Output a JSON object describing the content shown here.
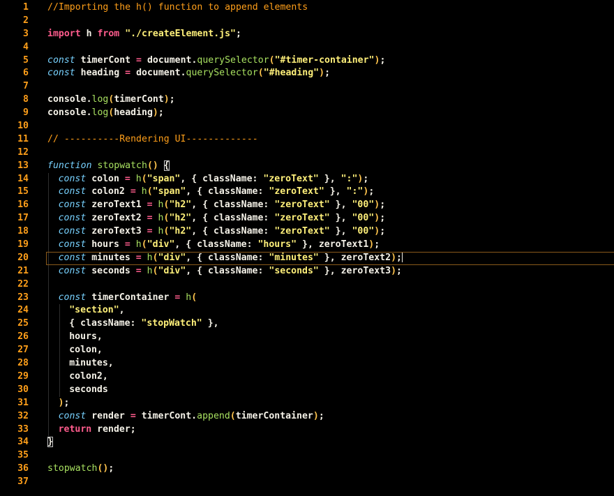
{
  "editor": {
    "current_line": 20,
    "lines": [
      {
        "n": "1",
        "tokens": [
          {
            "t": "//Importing the h() function to append elements",
            "c": "comment"
          }
        ]
      },
      {
        "n": "2",
        "tokens": []
      },
      {
        "n": "3",
        "tokens": [
          {
            "t": "import",
            "c": "kw"
          },
          {
            "t": " h ",
            "c": "plain"
          },
          {
            "t": "from",
            "c": "kw"
          },
          {
            "t": " ",
            "c": "plain"
          },
          {
            "t": "\"./createElement.js\"",
            "c": "str"
          },
          {
            "t": ";",
            "c": "plain"
          }
        ]
      },
      {
        "n": "4",
        "tokens": []
      },
      {
        "n": "5",
        "tokens": [
          {
            "t": "const",
            "c": "storage"
          },
          {
            "t": " timerCont ",
            "c": "plain"
          },
          {
            "t": "=",
            "c": "kw"
          },
          {
            "t": " document.",
            "c": "plain"
          },
          {
            "t": "querySelector",
            "c": "fn"
          },
          {
            "t": "(",
            "c": "punct"
          },
          {
            "t": "\"#timer-container\"",
            "c": "str"
          },
          {
            "t": ")",
            "c": "punct"
          },
          {
            "t": ";",
            "c": "plain"
          }
        ]
      },
      {
        "n": "6",
        "tokens": [
          {
            "t": "const",
            "c": "storage"
          },
          {
            "t": " heading ",
            "c": "plain"
          },
          {
            "t": "=",
            "c": "kw"
          },
          {
            "t": " document.",
            "c": "plain"
          },
          {
            "t": "querySelector",
            "c": "fn"
          },
          {
            "t": "(",
            "c": "punct"
          },
          {
            "t": "\"#heading\"",
            "c": "str"
          },
          {
            "t": ")",
            "c": "punct"
          },
          {
            "t": ";",
            "c": "plain"
          }
        ]
      },
      {
        "n": "7",
        "tokens": []
      },
      {
        "n": "8",
        "tokens": [
          {
            "t": "console.",
            "c": "plain"
          },
          {
            "t": "log",
            "c": "fn"
          },
          {
            "t": "(",
            "c": "punct"
          },
          {
            "t": "timerCont",
            "c": "plain"
          },
          {
            "t": ")",
            "c": "punct"
          },
          {
            "t": ";",
            "c": "plain"
          }
        ]
      },
      {
        "n": "9",
        "tokens": [
          {
            "t": "console.",
            "c": "plain"
          },
          {
            "t": "log",
            "c": "fn"
          },
          {
            "t": "(",
            "c": "punct"
          },
          {
            "t": "heading",
            "c": "plain"
          },
          {
            "t": ")",
            "c": "punct"
          },
          {
            "t": ";",
            "c": "plain"
          }
        ]
      },
      {
        "n": "10",
        "tokens": []
      },
      {
        "n": "11",
        "tokens": [
          {
            "t": "// ----------Rendering UI-------------",
            "c": "comment"
          }
        ]
      },
      {
        "n": "12",
        "tokens": []
      },
      {
        "n": "13",
        "tokens": [
          {
            "t": "function",
            "c": "storage"
          },
          {
            "t": " ",
            "c": "plain"
          },
          {
            "t": "stopwatch",
            "c": "fn"
          },
          {
            "t": "() ",
            "c": "punct"
          },
          {
            "t": "{",
            "c": "bracket"
          }
        ]
      },
      {
        "n": "14",
        "indent": 1,
        "tokens": [
          {
            "t": "const",
            "c": "storage"
          },
          {
            "t": " colon ",
            "c": "plain"
          },
          {
            "t": "=",
            "c": "kw"
          },
          {
            "t": " ",
            "c": "plain"
          },
          {
            "t": "h",
            "c": "fn"
          },
          {
            "t": "(",
            "c": "punct"
          },
          {
            "t": "\"span\"",
            "c": "str"
          },
          {
            "t": ", { className: ",
            "c": "plain"
          },
          {
            "t": "\"zeroText\"",
            "c": "str"
          },
          {
            "t": " }, ",
            "c": "plain"
          },
          {
            "t": "\":\"",
            "c": "str"
          },
          {
            "t": ")",
            "c": "punct"
          },
          {
            "t": ";",
            "c": "plain"
          }
        ]
      },
      {
        "n": "15",
        "indent": 1,
        "tokens": [
          {
            "t": "const",
            "c": "storage"
          },
          {
            "t": " colon2 ",
            "c": "plain"
          },
          {
            "t": "=",
            "c": "kw"
          },
          {
            "t": " ",
            "c": "plain"
          },
          {
            "t": "h",
            "c": "fn"
          },
          {
            "t": "(",
            "c": "punct"
          },
          {
            "t": "\"span\"",
            "c": "str"
          },
          {
            "t": ", { className: ",
            "c": "plain"
          },
          {
            "t": "\"zeroText\"",
            "c": "str"
          },
          {
            "t": " }, ",
            "c": "plain"
          },
          {
            "t": "\":\"",
            "c": "str"
          },
          {
            "t": ")",
            "c": "punct"
          },
          {
            "t": ";",
            "c": "plain"
          }
        ]
      },
      {
        "n": "16",
        "indent": 1,
        "tokens": [
          {
            "t": "const",
            "c": "storage"
          },
          {
            "t": " zeroText1 ",
            "c": "plain"
          },
          {
            "t": "=",
            "c": "kw"
          },
          {
            "t": " ",
            "c": "plain"
          },
          {
            "t": "h",
            "c": "fn"
          },
          {
            "t": "(",
            "c": "punct"
          },
          {
            "t": "\"h2\"",
            "c": "str"
          },
          {
            "t": ", { className: ",
            "c": "plain"
          },
          {
            "t": "\"zeroText\"",
            "c": "str"
          },
          {
            "t": " }, ",
            "c": "plain"
          },
          {
            "t": "\"00\"",
            "c": "str"
          },
          {
            "t": ")",
            "c": "punct"
          },
          {
            "t": ";",
            "c": "plain"
          }
        ]
      },
      {
        "n": "17",
        "indent": 1,
        "tokens": [
          {
            "t": "const",
            "c": "storage"
          },
          {
            "t": " zeroText2 ",
            "c": "plain"
          },
          {
            "t": "=",
            "c": "kw"
          },
          {
            "t": " ",
            "c": "plain"
          },
          {
            "t": "h",
            "c": "fn"
          },
          {
            "t": "(",
            "c": "punct"
          },
          {
            "t": "\"h2\"",
            "c": "str"
          },
          {
            "t": ", { className: ",
            "c": "plain"
          },
          {
            "t": "\"zeroText\"",
            "c": "str"
          },
          {
            "t": " }, ",
            "c": "plain"
          },
          {
            "t": "\"00\"",
            "c": "str"
          },
          {
            "t": ")",
            "c": "punct"
          },
          {
            "t": ";",
            "c": "plain"
          }
        ]
      },
      {
        "n": "18",
        "indent": 1,
        "tokens": [
          {
            "t": "const",
            "c": "storage"
          },
          {
            "t": " zeroText3 ",
            "c": "plain"
          },
          {
            "t": "=",
            "c": "kw"
          },
          {
            "t": " ",
            "c": "plain"
          },
          {
            "t": "h",
            "c": "fn"
          },
          {
            "t": "(",
            "c": "punct"
          },
          {
            "t": "\"h2\"",
            "c": "str"
          },
          {
            "t": ", { className: ",
            "c": "plain"
          },
          {
            "t": "\"zeroText\"",
            "c": "str"
          },
          {
            "t": " }, ",
            "c": "plain"
          },
          {
            "t": "\"00\"",
            "c": "str"
          },
          {
            "t": ")",
            "c": "punct"
          },
          {
            "t": ";",
            "c": "plain"
          }
        ]
      },
      {
        "n": "19",
        "indent": 1,
        "tokens": [
          {
            "t": "const",
            "c": "storage"
          },
          {
            "t": " hours ",
            "c": "plain"
          },
          {
            "t": "=",
            "c": "kw"
          },
          {
            "t": " ",
            "c": "plain"
          },
          {
            "t": "h",
            "c": "fn"
          },
          {
            "t": "(",
            "c": "punct"
          },
          {
            "t": "\"div\"",
            "c": "str"
          },
          {
            "t": ", { className: ",
            "c": "plain"
          },
          {
            "t": "\"hours\"",
            "c": "str"
          },
          {
            "t": " }, zeroText1",
            "c": "plain"
          },
          {
            "t": ")",
            "c": "punct"
          },
          {
            "t": ";",
            "c": "plain"
          }
        ]
      },
      {
        "n": "20",
        "indent": 1,
        "caret": true,
        "tokens": [
          {
            "t": "const",
            "c": "storage"
          },
          {
            "t": " minutes ",
            "c": "plain"
          },
          {
            "t": "=",
            "c": "kw"
          },
          {
            "t": " ",
            "c": "plain"
          },
          {
            "t": "h",
            "c": "fn"
          },
          {
            "t": "(",
            "c": "punct"
          },
          {
            "t": "\"div\"",
            "c": "str"
          },
          {
            "t": ", { className: ",
            "c": "plain"
          },
          {
            "t": "\"minutes\"",
            "c": "str"
          },
          {
            "t": " }, zeroText2",
            "c": "plain"
          },
          {
            "t": ")",
            "c": "punct"
          },
          {
            "t": ";",
            "c": "plain"
          }
        ]
      },
      {
        "n": "21",
        "indent": 1,
        "tokens": [
          {
            "t": "const",
            "c": "storage"
          },
          {
            "t": " seconds ",
            "c": "plain"
          },
          {
            "t": "=",
            "c": "kw"
          },
          {
            "t": " ",
            "c": "plain"
          },
          {
            "t": "h",
            "c": "fn"
          },
          {
            "t": "(",
            "c": "punct"
          },
          {
            "t": "\"div\"",
            "c": "str"
          },
          {
            "t": ", { className: ",
            "c": "plain"
          },
          {
            "t": "\"seconds\"",
            "c": "str"
          },
          {
            "t": " }, zeroText3",
            "c": "plain"
          },
          {
            "t": ")",
            "c": "punct"
          },
          {
            "t": ";",
            "c": "plain"
          }
        ]
      },
      {
        "n": "22",
        "indent": 1,
        "tokens": []
      },
      {
        "n": "23",
        "indent": 1,
        "tokens": [
          {
            "t": "const",
            "c": "storage"
          },
          {
            "t": " timerContainer ",
            "c": "plain"
          },
          {
            "t": "=",
            "c": "kw"
          },
          {
            "t": " ",
            "c": "plain"
          },
          {
            "t": "h",
            "c": "fn"
          },
          {
            "t": "(",
            "c": "punct"
          }
        ]
      },
      {
        "n": "24",
        "indent": 2,
        "tokens": [
          {
            "t": "\"section\"",
            "c": "str"
          },
          {
            "t": ",",
            "c": "plain"
          }
        ]
      },
      {
        "n": "25",
        "indent": 2,
        "tokens": [
          {
            "t": "{ className: ",
            "c": "plain"
          },
          {
            "t": "\"stopWatch\"",
            "c": "str"
          },
          {
            "t": " },",
            "c": "plain"
          }
        ]
      },
      {
        "n": "26",
        "indent": 2,
        "tokens": [
          {
            "t": "hours,",
            "c": "plain"
          }
        ]
      },
      {
        "n": "27",
        "indent": 2,
        "tokens": [
          {
            "t": "colon,",
            "c": "plain"
          }
        ]
      },
      {
        "n": "28",
        "indent": 2,
        "tokens": [
          {
            "t": "minutes,",
            "c": "plain"
          }
        ]
      },
      {
        "n": "29",
        "indent": 2,
        "tokens": [
          {
            "t": "colon2,",
            "c": "plain"
          }
        ]
      },
      {
        "n": "30",
        "indent": 2,
        "tokens": [
          {
            "t": "seconds",
            "c": "plain"
          }
        ]
      },
      {
        "n": "31",
        "indent": 1,
        "tokens": [
          {
            "t": ")",
            "c": "punct"
          },
          {
            "t": ";",
            "c": "plain"
          }
        ]
      },
      {
        "n": "32",
        "indent": 1,
        "tokens": [
          {
            "t": "const",
            "c": "storage"
          },
          {
            "t": " render ",
            "c": "plain"
          },
          {
            "t": "=",
            "c": "kw"
          },
          {
            "t": " timerCont.",
            "c": "plain"
          },
          {
            "t": "append",
            "c": "fn"
          },
          {
            "t": "(",
            "c": "punct"
          },
          {
            "t": "timerContainer",
            "c": "plain"
          },
          {
            "t": ")",
            "c": "punct"
          },
          {
            "t": ";",
            "c": "plain"
          }
        ]
      },
      {
        "n": "33",
        "indent": 1,
        "tokens": [
          {
            "t": "return",
            "c": "kw"
          },
          {
            "t": " render;",
            "c": "plain"
          }
        ]
      },
      {
        "n": "34",
        "tokens": [
          {
            "t": "}",
            "c": "bracket"
          }
        ]
      },
      {
        "n": "35",
        "tokens": []
      },
      {
        "n": "36",
        "tokens": [
          {
            "t": "stopwatch",
            "c": "fn"
          },
          {
            "t": "()",
            "c": "punct"
          },
          {
            "t": ";",
            "c": "plain"
          }
        ]
      },
      {
        "n": "37",
        "tokens": []
      }
    ]
  }
}
